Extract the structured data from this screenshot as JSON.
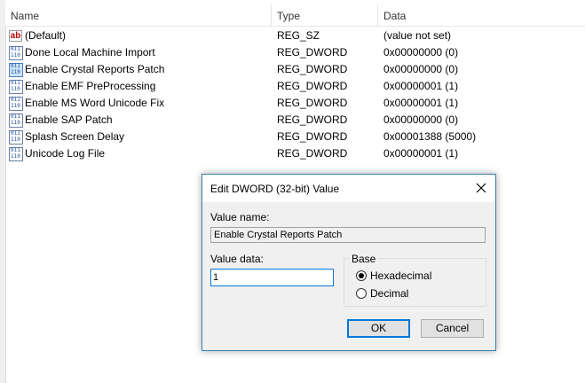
{
  "columns": {
    "name": "Name",
    "type": "Type",
    "data": "Data"
  },
  "rows": [
    {
      "icon": "string-value-icon",
      "name": "(Default)",
      "type": "REG_SZ",
      "data": "(value not set)"
    },
    {
      "icon": "binary-value-icon",
      "name": "Done Local Machine Import",
      "type": "REG_DWORD",
      "data": "0x00000000 (0)"
    },
    {
      "icon": "binary-value-icon",
      "name": "Enable Crystal Reports Patch",
      "type": "REG_DWORD",
      "data": "0x00000000 (0)",
      "selected": true
    },
    {
      "icon": "binary-value-icon",
      "name": "Enable EMF PreProcessing",
      "type": "REG_DWORD",
      "data": "0x00000001 (1)"
    },
    {
      "icon": "binary-value-icon",
      "name": "Enable MS Word Unicode Fix",
      "type": "REG_DWORD",
      "data": "0x00000001 (1)"
    },
    {
      "icon": "binary-value-icon",
      "name": "Enable SAP Patch",
      "type": "REG_DWORD",
      "data": "0x00000000 (0)"
    },
    {
      "icon": "binary-value-icon",
      "name": "Splash Screen Delay",
      "type": "REG_DWORD",
      "data": "0x00001388 (5000)"
    },
    {
      "icon": "binary-value-icon",
      "name": "Unicode Log File",
      "type": "REG_DWORD",
      "data": "0x00000001 (1)"
    }
  ],
  "dialog": {
    "title": "Edit DWORD (32-bit) Value",
    "value_name_label": "Value name:",
    "value_name": "Enable Crystal Reports Patch",
    "value_data_label": "Value data:",
    "value_data": "1",
    "base_label": "Base",
    "hex_label": "Hexadecimal",
    "dec_label": "Decimal",
    "base_selected": "Hexadecimal",
    "ok_label": "OK",
    "cancel_label": "Cancel"
  },
  "colors": {
    "accent": "#0078d7",
    "dialog_border": "#3c7fb1",
    "dialog_bg": "#f0f0f0"
  }
}
